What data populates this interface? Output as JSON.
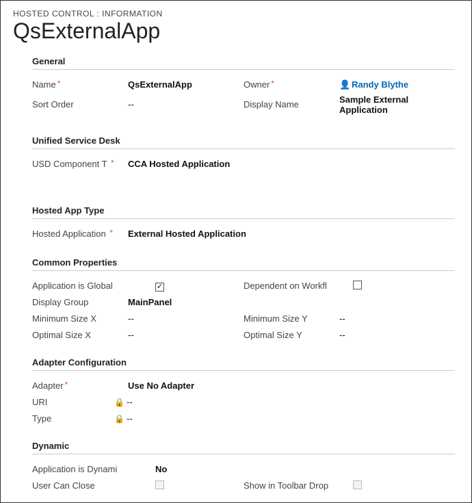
{
  "breadcrumb": "HOSTED CONTROL : INFORMATION",
  "title": "QsExternalApp",
  "sections": {
    "general": {
      "header": "General",
      "name_label": "Name",
      "name_value": "QsExternalApp",
      "owner_label": "Owner",
      "owner_value": "Randy Blythe",
      "sort_order_label": "Sort Order",
      "sort_order_value": "--",
      "display_name_label": "Display Name",
      "display_name_value": "Sample External Application"
    },
    "usd": {
      "header": "Unified Service Desk",
      "component_label": "USD Component T",
      "component_value": "CCA Hosted Application"
    },
    "hosted_type": {
      "header": "Hosted App Type",
      "hosted_app_label": "Hosted Application",
      "hosted_app_value": "External Hosted Application"
    },
    "common": {
      "header": "Common Properties",
      "global_label": "Application is Global",
      "global_checked": "✓",
      "dep_workflow_label": "Dependent on Workfl",
      "display_group_label": "Display Group",
      "display_group_value": "MainPanel",
      "min_x_label": "Minimum Size X",
      "min_x_value": "--",
      "min_y_label": "Minimum Size Y",
      "min_y_value": "--",
      "opt_x_label": "Optimal Size X",
      "opt_x_value": "--",
      "opt_y_label": "Optimal Size Y",
      "opt_y_value": "--"
    },
    "adapter": {
      "header": "Adapter Configuration",
      "adapter_label": "Adapter",
      "adapter_value": "Use No Adapter",
      "uri_label": "URI",
      "uri_value": "--",
      "type_label": "Type",
      "type_value": "--"
    },
    "dynamic": {
      "header": "Dynamic",
      "is_dynamic_label": "Application is Dynami",
      "is_dynamic_value": "No",
      "can_close_label": "User Can Close",
      "show_toolbar_label": "Show in Toolbar Drop"
    }
  },
  "glyphs": {
    "lock": "🔒",
    "person": "👤",
    "asterisk": "*"
  }
}
